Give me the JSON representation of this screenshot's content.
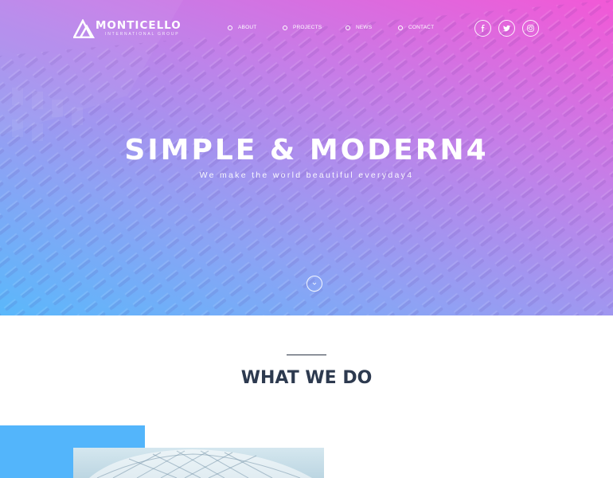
{
  "header": {
    "logo_name": "MONTICELLO",
    "logo_sub": "INTERNATIONAL GROUP",
    "nav": [
      {
        "label": "ABOUT"
      },
      {
        "label": "PROJECTS"
      },
      {
        "label": "NEWS"
      },
      {
        "label": "CONTACT"
      }
    ],
    "social": [
      {
        "icon": "facebook-icon"
      },
      {
        "icon": "twitter-icon"
      },
      {
        "icon": "instagram-icon"
      }
    ]
  },
  "hero": {
    "title": "SIMPLE & MODERN4",
    "subtitle": "We make the world beautiful everyday4",
    "scroll_icon": "chevron-down-icon",
    "colors": {
      "pink": "#f258d6",
      "purple": "#c47fe8",
      "blue": "#5ab8fb"
    }
  },
  "section": {
    "title": "WHAT WE DO"
  },
  "colors": {
    "accent_blue": "#53b5fb",
    "heading_dark": "#2d3a4f"
  }
}
